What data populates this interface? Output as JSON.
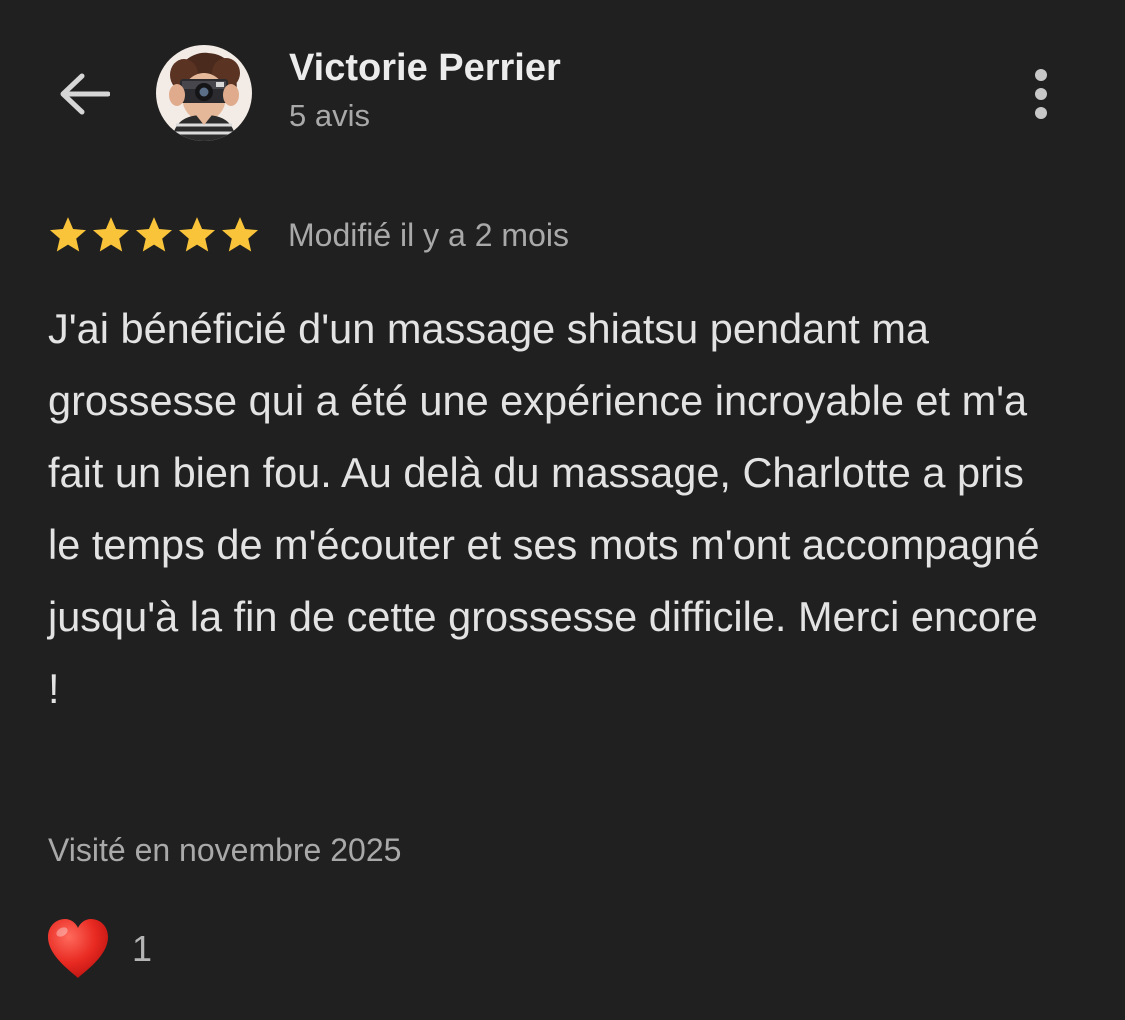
{
  "header": {
    "back_icon": "arrow-left-icon",
    "user_name": "Victorie Perrier",
    "review_count": "5 avis",
    "more_icon": "more-vertical-icon"
  },
  "review": {
    "rating": 5,
    "rating_max": 5,
    "star_color": "#f9c43a",
    "edited_label": "Modifié il y a 2 mois",
    "text": "J'ai bénéficié d'un massage shiatsu pendant ma grossesse qui a été une expérience incroyable et m'a fait un bien fou. Au delà du massage, Charlotte a pris le temps de m'écouter et ses mots m'ont accompagné jusqu'à la fin de cette grossesse difficile. Merci encore !",
    "visit_label": "Visité en novembre 2025"
  },
  "reaction": {
    "icon": "heart-icon",
    "color": "#e02420",
    "count": "1"
  },
  "theme": {
    "background": "#202020",
    "text_primary": "#e3e3e3",
    "text_secondary": "#a9a9a9"
  }
}
